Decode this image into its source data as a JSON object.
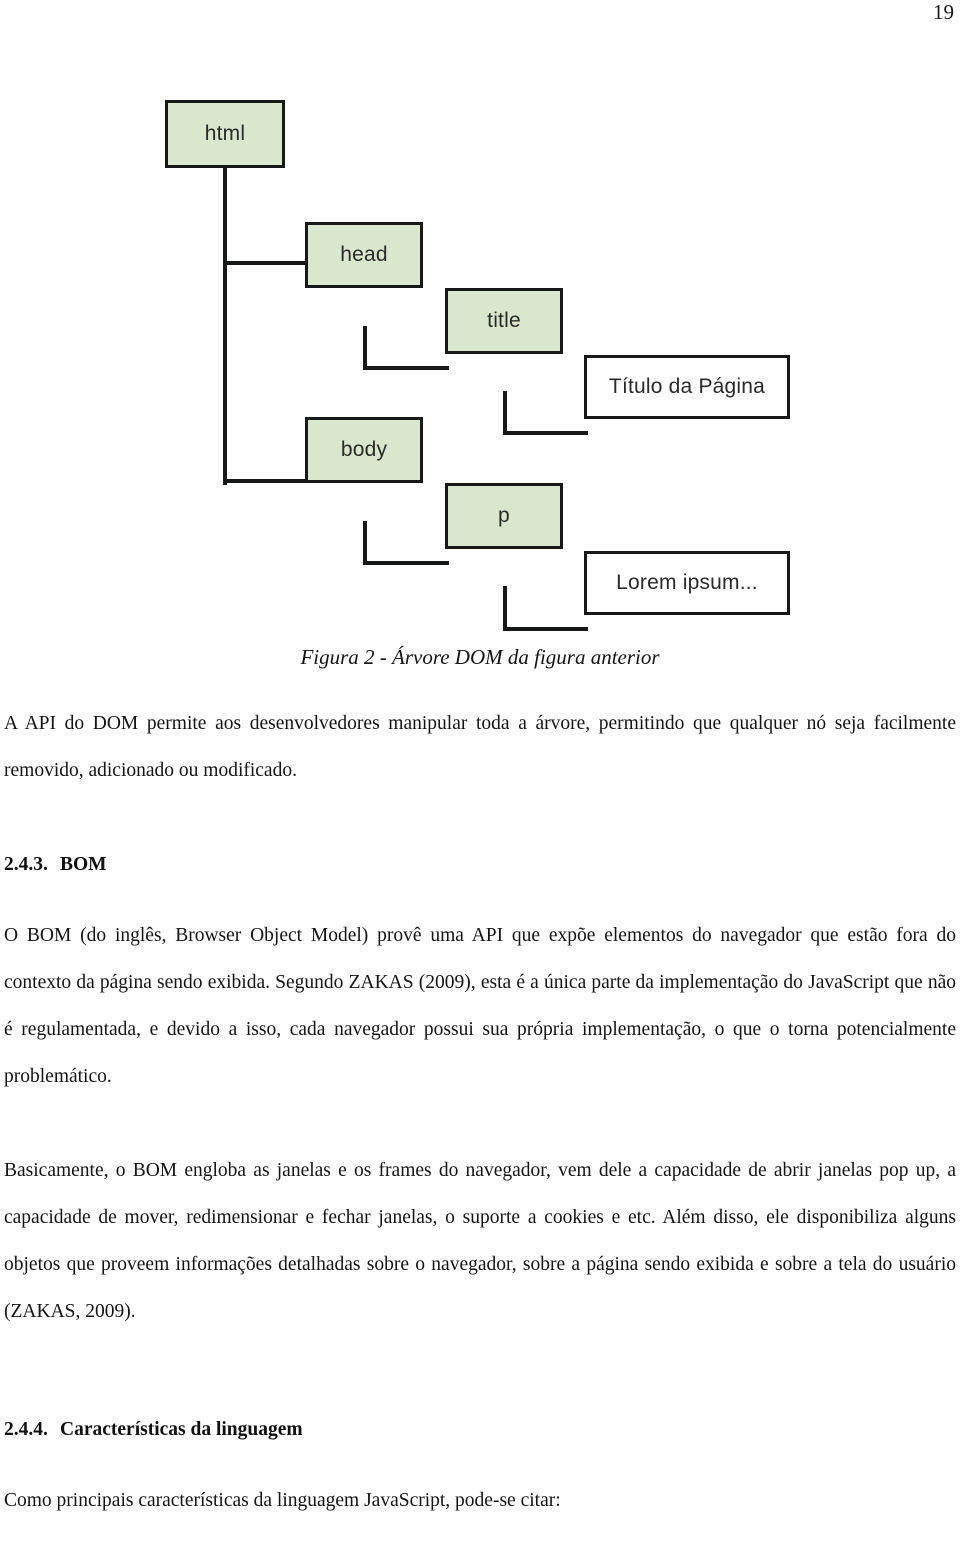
{
  "page": {
    "number": "19"
  },
  "figure": {
    "caption": "Figura 2 - Árvore DOM da figura anterior",
    "tree": {
      "nodes": [
        {
          "id": "html",
          "label": "html",
          "kind": "element"
        },
        {
          "id": "head",
          "label": "head",
          "kind": "element"
        },
        {
          "id": "title",
          "label": "title",
          "kind": "element"
        },
        {
          "id": "title_text",
          "label": "Título da Página",
          "kind": "text"
        },
        {
          "id": "body",
          "label": "body",
          "kind": "element"
        },
        {
          "id": "p",
          "label": "p",
          "kind": "element"
        },
        {
          "id": "p_text",
          "label": "Lorem ipsum...",
          "kind": "text"
        }
      ],
      "colors": {
        "element_fill": "#d9e7cd",
        "text_fill": "#ffffff",
        "border": "#17181a",
        "connector": "#17181a"
      }
    }
  },
  "content": {
    "paragraph_dom_api": "A API do DOM permite aos desenvolvedores manipular toda a árvore, permitindo que qualquer nó seja facilmente removido, adicionado ou modificado.",
    "heading_bom": {
      "number": "2.4.3.",
      "title": "BOM"
    },
    "paragraph_bom_1": "O BOM (do inglês, Browser Object Model) provê uma API que expõe elementos do navegador que estão fora do contexto da página sendo exibida. Segundo ZAKAS (2009), esta é a única parte da implementação do JavaScript que não é regulamentada, e devido a isso, cada navegador possui sua própria implementação, o que o torna potencialmente problemático.",
    "paragraph_bom_2": "Basicamente, o BOM engloba as janelas e os frames do navegador, vem dele a capacidade de abrir janelas pop up, a capacidade de mover, redimensionar e fechar janelas, o suporte a cookies e etc. Além disso, ele disponibiliza alguns objetos que proveem informações detalhadas sobre o navegador, sobre a página sendo exibida e sobre a tela do usuário (ZAKAS, 2009).",
    "heading_features": {
      "number": "2.4.4.",
      "title": "Características da linguagem"
    },
    "paragraph_features_intro": "Como principais características da linguagem JavaScript, pode-se citar:"
  }
}
